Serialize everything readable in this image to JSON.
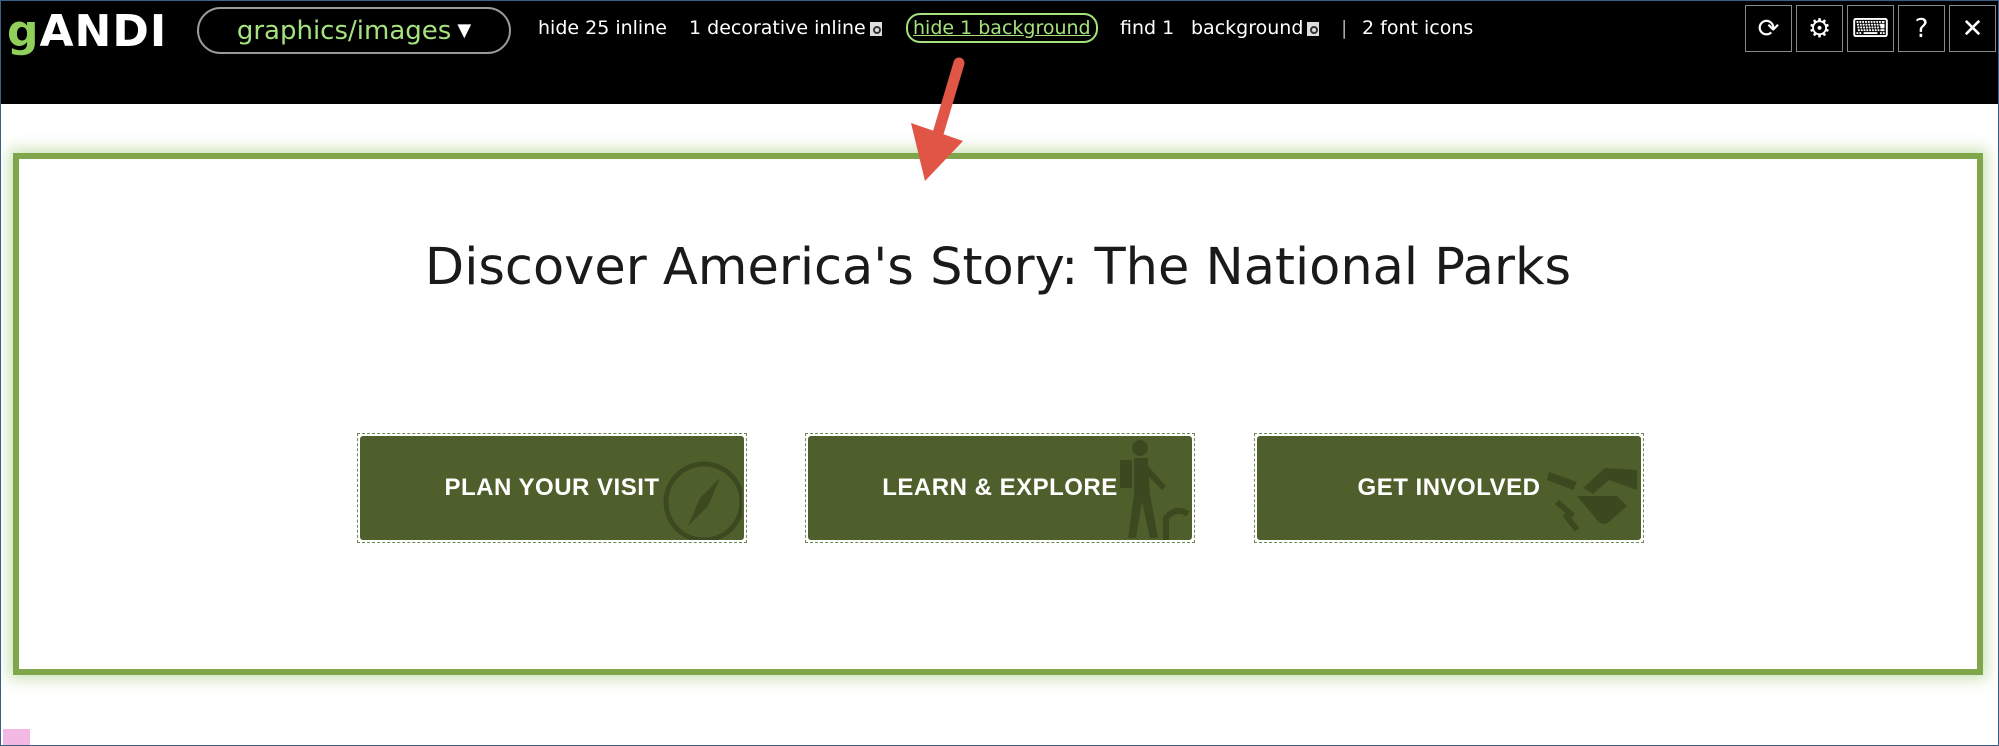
{
  "toolbar": {
    "logo_g": "g",
    "logo_andi": "ANDI",
    "mode_select": "graphics/images",
    "hide_inline": "hide 25 inline",
    "decorative_inline": "1 decorative inline",
    "hide_background": "hide 1   background",
    "find": "find 1",
    "background": "background",
    "separator": "|",
    "font_icons": "2 font icons",
    "buttons": {
      "refresh": "⟳",
      "settings": "⚙",
      "keyboard": "⌨",
      "help": "?",
      "close": "✕"
    }
  },
  "page": {
    "heading": "Discover America's Story: The National Parks",
    "buttons": [
      {
        "label": "PLAN YOUR VISIT",
        "icon": "compass-icon"
      },
      {
        "label": "LEARN & EXPLORE",
        "icon": "hiker-icon"
      },
      {
        "label": "GET INVOLVED",
        "icon": "handshake-icon"
      }
    ]
  },
  "colors": {
    "toolbar_bg": "#000000",
    "andi_green": "#a5e27d",
    "highlight_border": "#7fa64a",
    "button_bg": "#4f5f2b",
    "arrow": "#e05545"
  }
}
